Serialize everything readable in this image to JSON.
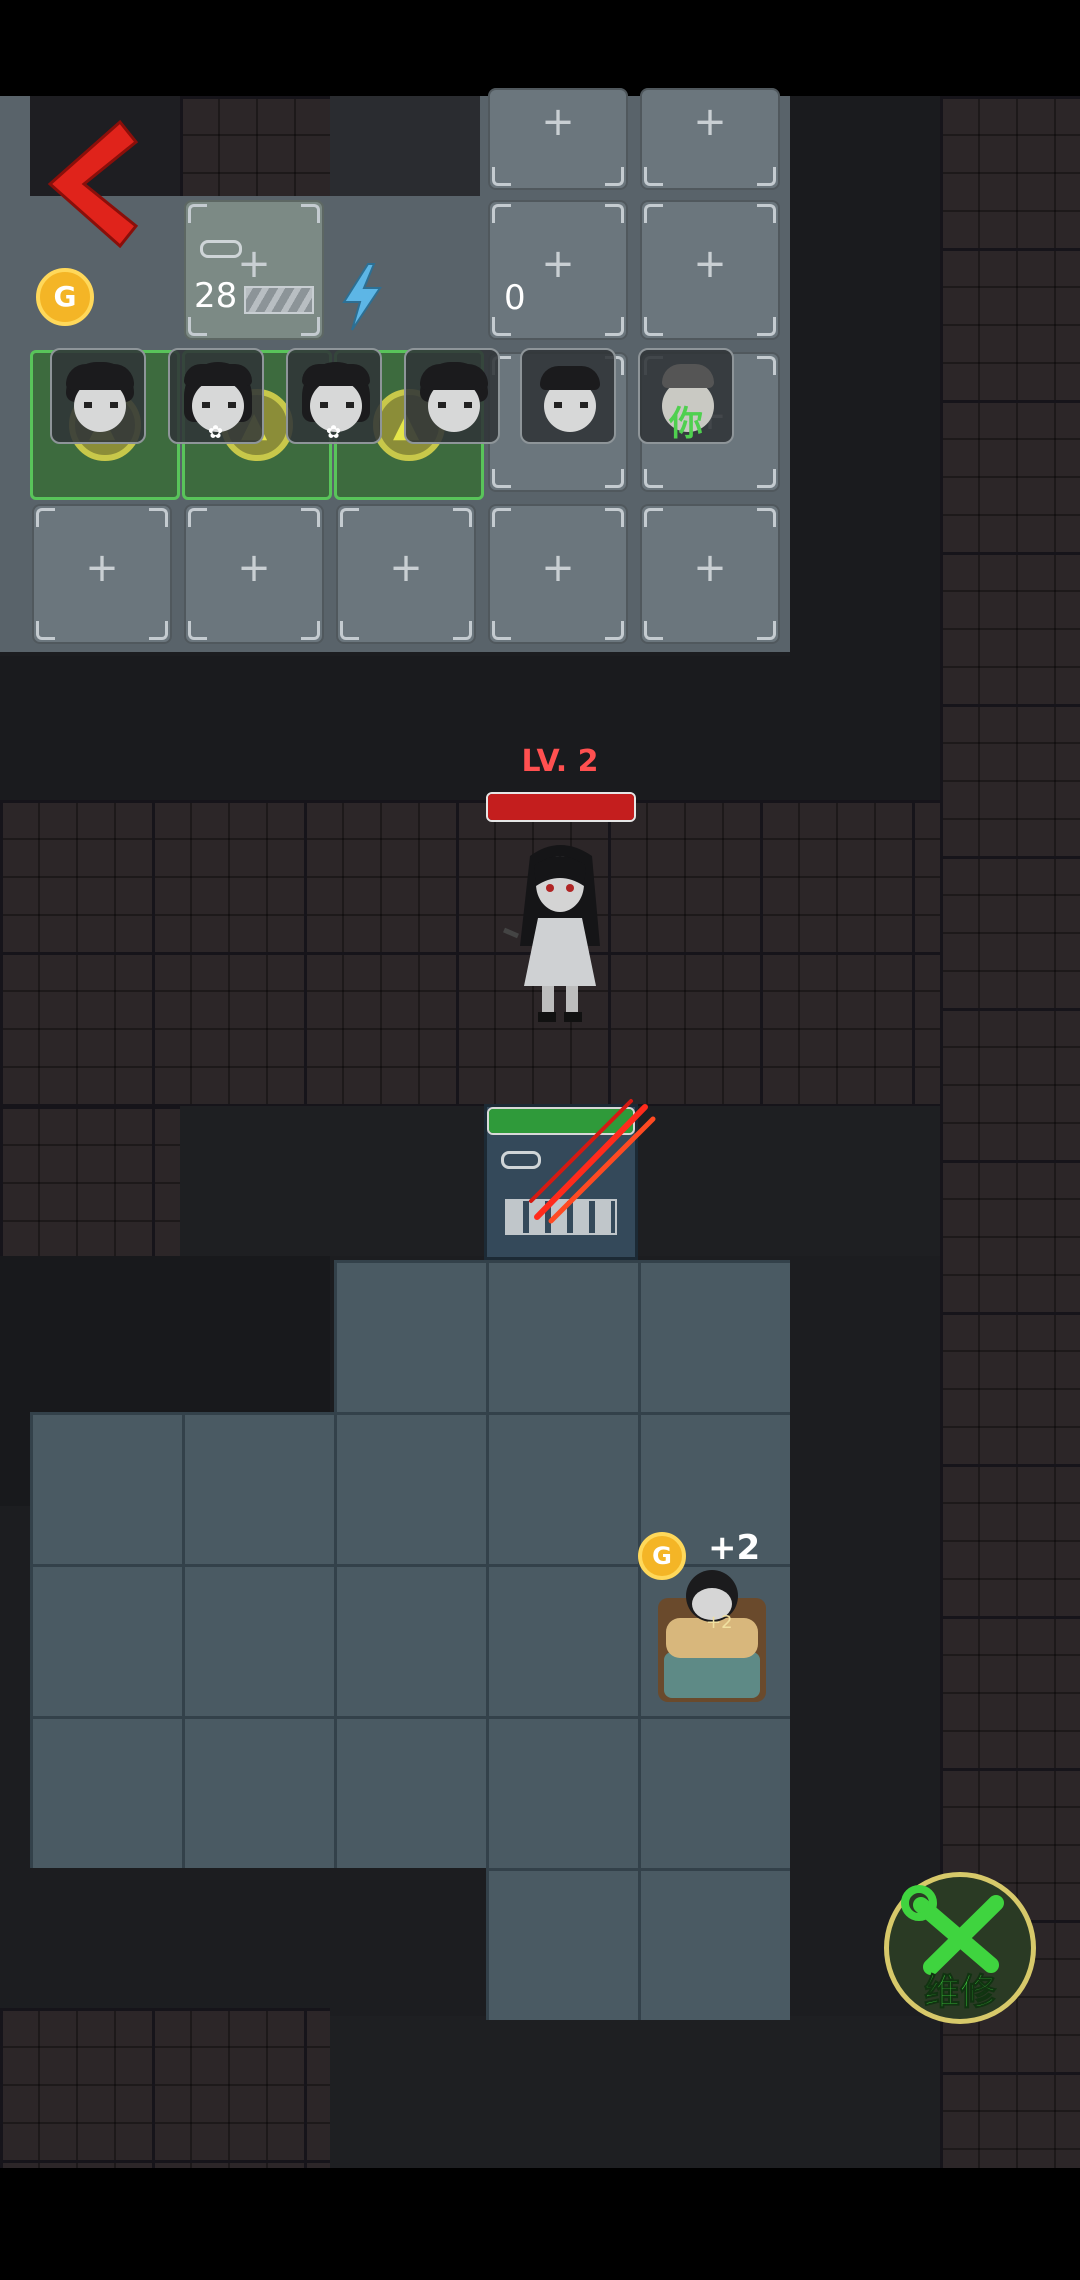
{
  "hud": {
    "back_icon": "back-chevron-icon",
    "gold_coin_label": "G",
    "door_value": "28",
    "energy_value": "0"
  },
  "roster": {
    "you_label": "你",
    "avatars": [
      "player-avatar-1",
      "player-avatar-2",
      "player-avatar-3",
      "player-avatar-4",
      "player-avatar-5",
      "player-avatar-you"
    ]
  },
  "empty_cell_symbol": "+",
  "ghost": {
    "level_label": "LV. 2",
    "health_fraction": 1.0
  },
  "door": {
    "health_fraction": 1.0
  },
  "bed": {
    "coin_label": "G",
    "gain_label": "+2",
    "small_gain_label": "+2"
  },
  "repair_button": {
    "label": "维修"
  },
  "colors": {
    "back_chevron": "#e0231b",
    "ghost_health": "#c41e1e",
    "door_health": "#2f9a3a",
    "repair_green": "#3fd43f",
    "level_text": "#ff5050"
  }
}
